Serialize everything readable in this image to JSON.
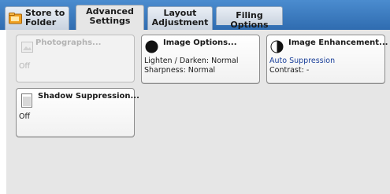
{
  "tabs": [
    {
      "line1": "Store to",
      "line2": "Folder"
    },
    {
      "line1": "Advanced",
      "line2": "Settings"
    },
    {
      "line1": "Layout",
      "line2": "Adjustment"
    },
    {
      "line1": "Filing Options"
    }
  ],
  "active_tab": "Advanced Settings",
  "options": {
    "photographs": {
      "title": "Photographs...",
      "value": "Off",
      "enabled": false
    },
    "image_options": {
      "title": "Image Options...",
      "line1": "Lighten / Darken: Normal",
      "line2": "Sharpness: Normal"
    },
    "image_enhancement": {
      "title": "Image Enhancement...",
      "line1": "Auto Suppression",
      "line2": "Contrast: -"
    },
    "shadow_suppression": {
      "title": "Shadow Suppression...",
      "value": "Off"
    }
  },
  "icons": {
    "store_tab": "folder-icon",
    "photographs": "photo-icon",
    "image_options": "black-circle-icon",
    "image_enhancement": "half-circle-icon",
    "shadow_suppression": "document-icon"
  },
  "colors": {
    "tab_bar": "#3a7bc0",
    "panel": "#e6e6e6",
    "highlight_text": "#1a3f99"
  }
}
